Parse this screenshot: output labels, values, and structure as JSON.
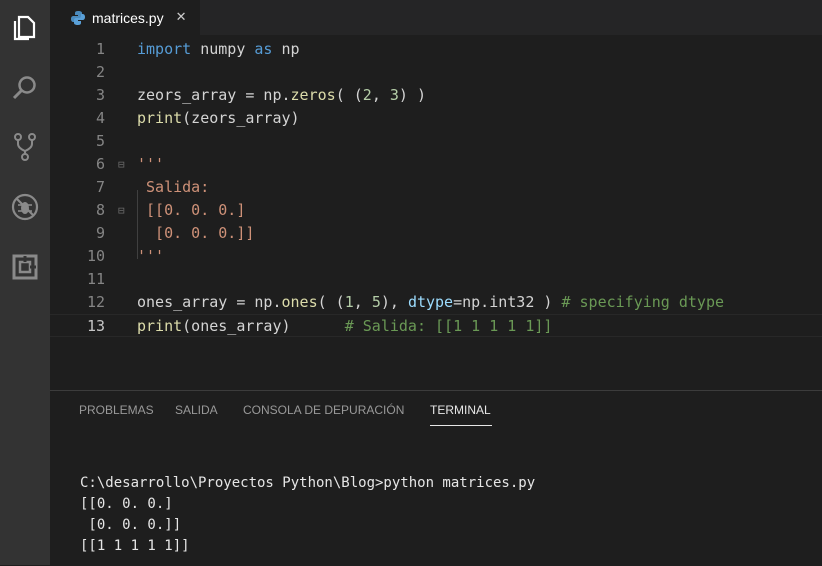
{
  "activity_bar": {
    "items": [
      {
        "name": "explorer",
        "icon": "files-icon"
      },
      {
        "name": "search",
        "icon": "search-icon"
      },
      {
        "name": "source-control",
        "icon": "git-branch-icon"
      },
      {
        "name": "debug",
        "icon": "debug-icon"
      },
      {
        "name": "extensions",
        "icon": "extensions-icon"
      }
    ]
  },
  "tab": {
    "label": "matrices.py",
    "close": "✕"
  },
  "editor": {
    "lines": [
      {
        "n": "1"
      },
      {
        "n": "2"
      },
      {
        "n": "3"
      },
      {
        "n": "4"
      },
      {
        "n": "5"
      },
      {
        "n": "6"
      },
      {
        "n": "7"
      },
      {
        "n": "8"
      },
      {
        "n": "9"
      },
      {
        "n": "10"
      },
      {
        "n": "11"
      },
      {
        "n": "12"
      },
      {
        "n": "13"
      }
    ],
    "code": {
      "l1": {
        "a": "import",
        "b": " numpy ",
        "c": "as",
        "d": " np"
      },
      "l3": {
        "a": "zeors_array = np.",
        "b": "zeros",
        "c": "( (",
        "d": "2",
        "e": ", ",
        "f": "3",
        "g": ") )"
      },
      "l4": {
        "a": "print",
        "b": "(zeors_array)"
      },
      "l6": "'''",
      "l7": " Salida:",
      "l8": " [[0. 0. 0.]",
      "l9": "  [0. 0. 0.]]",
      "l10": "'''",
      "l12": {
        "a": "ones_array = np.",
        "b": "ones",
        "c": "( (",
        "d": "1",
        "e": ", ",
        "f": "5",
        "g": "), ",
        "h": "dtype",
        "i": "=np.int32 ) ",
        "j": "# specifying dtype"
      },
      "l13": {
        "a": "print",
        "b": "(ones_array)      ",
        "c": "# Salida: [[1 1 1 1 1]]"
      }
    },
    "current_line": 13
  },
  "panel": {
    "tabs": [
      "PROBLEMAS",
      "SALIDA",
      "CONSOLA DE DEPURACIÓN",
      "TERMINAL"
    ],
    "active_tab": "TERMINAL",
    "terminal_lines": [
      "C:\\desarrollo\\Proyectos Python\\Blog>python matrices.py",
      "[[0. 0. 0.]",
      " [0. 0. 0.]]",
      "[[1 1 1 1 1]]"
    ]
  },
  "colors": {
    "background": "#1e1e1e",
    "activity_bar": "#333333",
    "keyword": "#569cd6",
    "string": "#ce9178",
    "comment": "#6a9955"
  }
}
